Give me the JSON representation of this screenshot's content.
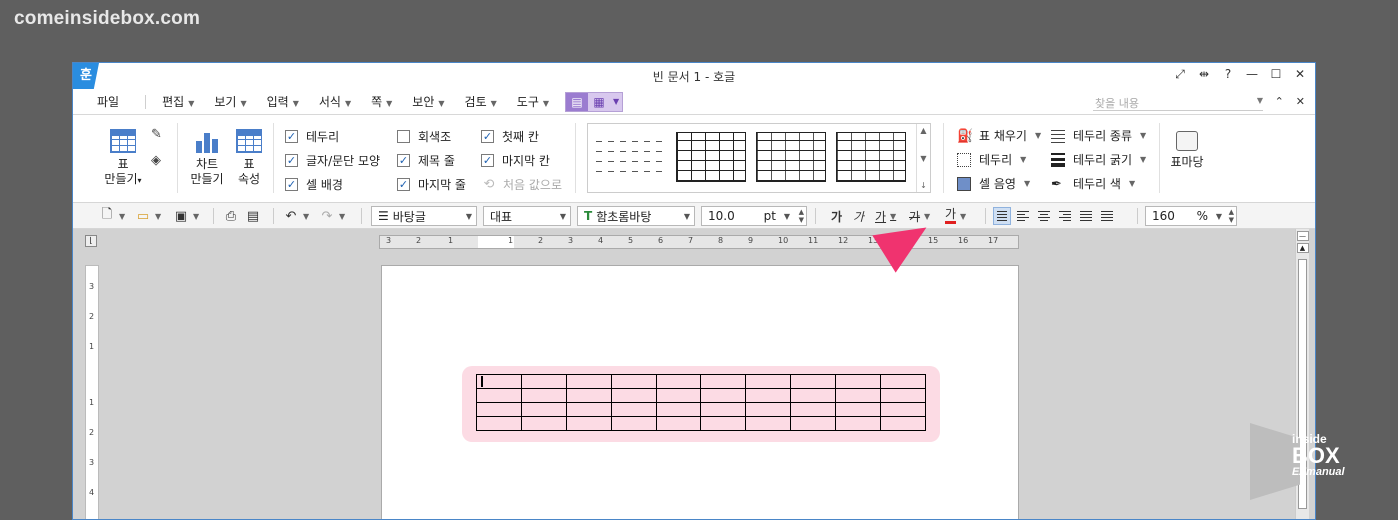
{
  "watermark": "comeinsidebox.com",
  "window": {
    "logo": "훈",
    "title": "빈 문서 1 - 호글",
    "controls": [
      "⤢",
      "⇹",
      "?",
      "—",
      "☐",
      "✕"
    ]
  },
  "menu": {
    "file": "파일",
    "items": [
      {
        "label": "편집"
      },
      {
        "label": "보기"
      },
      {
        "label": "입력"
      },
      {
        "label": "서식"
      },
      {
        "label": "쪽"
      },
      {
        "label": "보안"
      },
      {
        "label": "검토"
      },
      {
        "label": "도구"
      }
    ],
    "find_placeholder": "찾을 내용",
    "right_controls": [
      "⌃",
      "✕"
    ]
  },
  "ribbon": {
    "make_table": "표\n만들기",
    "make_table_l1": "표",
    "make_table_l2": "만들기",
    "chart_l1": "차트",
    "chart_l2": "만들기",
    "props_l1": "표",
    "props_l2": "속성",
    "checks": [
      {
        "label": "테두리",
        "checked": true
      },
      {
        "label": "글자/문단 모양",
        "checked": true
      },
      {
        "label": "셀 배경",
        "checked": true
      },
      {
        "label": "회색조",
        "checked": false
      },
      {
        "label": "제목 줄",
        "checked": true
      },
      {
        "label": "마지막 줄",
        "checked": true
      },
      {
        "label": "첫째 칸",
        "checked": true
      },
      {
        "label": "마지막 칸",
        "checked": true
      },
      {
        "label": "처음 값으로",
        "checked": false
      }
    ],
    "cell_fill": "표 채우기",
    "border": "테두리",
    "cell_shade": "셀 음영",
    "border_type": "테두리 종류",
    "border_width": "테두리 굵기",
    "border_color": "테두리 색",
    "table_fit": "표마당"
  },
  "toolbar": {
    "style": "바탕글",
    "lang": "대표",
    "font": "함초롬바탕",
    "font_icon": "T",
    "size": "10.0",
    "unit": "pt",
    "bold": "가",
    "italic": "가",
    "underline": "가",
    "strike": "가",
    "color": "가",
    "zoom": "160",
    "zoom_unit": "%"
  },
  "ruler": {
    "h_ticks": [
      "3",
      "2",
      "1",
      "1",
      "2",
      "3",
      "4",
      "5",
      "6",
      "7",
      "8",
      "9",
      "10",
      "11",
      "12",
      "13",
      "14",
      "15",
      "16",
      "17"
    ],
    "v_ticks": [
      "3",
      "2",
      "1",
      "1",
      "2",
      "3",
      "4"
    ]
  },
  "badge": {
    "line1": "inside",
    "line2": "BOX",
    "line3": "EZmanual"
  }
}
